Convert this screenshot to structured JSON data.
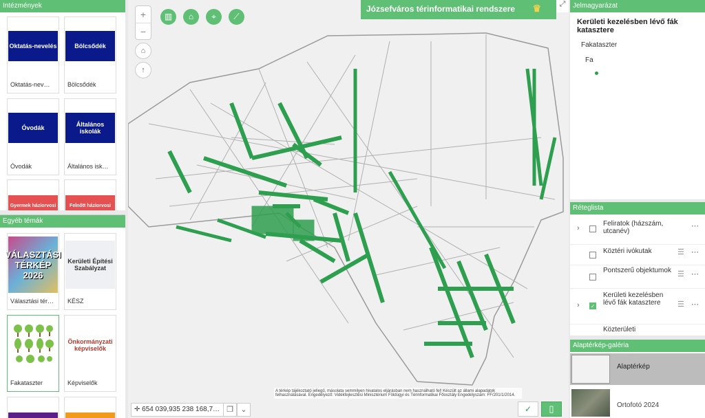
{
  "left_top": {
    "header": "Intézmények",
    "cards": [
      {
        "thumb_text": "Oktatás-nevelés",
        "caption": "Oktatás-nev…",
        "color": "#0a1a8a"
      },
      {
        "thumb_text": "Bölcsődék",
        "caption": "Bölcsődék",
        "color": "#0a1a8a"
      },
      {
        "thumb_text": "Óvodák",
        "caption": "Óvodák",
        "color": "#0a1a8a"
      },
      {
        "thumb_text": "Általános iskolák",
        "caption": "Általános isk…",
        "color": "#0a1a8a"
      },
      {
        "thumb_text": "Gyermek háziorvosi",
        "caption": "",
        "color": "#e55050"
      },
      {
        "thumb_text": "Felnőtt háziorvosi",
        "caption": "",
        "color": "#e55050"
      }
    ]
  },
  "left_bottom": {
    "header": "Egyéb témák",
    "cards": [
      {
        "thumb_text": "VÁLASZTÁSI TÉRKÉP 2026",
        "caption": "Választási tér…"
      },
      {
        "thumb_text": "Kerületi Építési Szabályzat",
        "caption": "KÉSZ"
      },
      {
        "thumb_text": "",
        "caption": "Fakataszter"
      },
      {
        "thumb_text": "Önkormányzati képviselők",
        "caption": "Képviselők"
      }
    ]
  },
  "map": {
    "title": "Józsefváros térinformatikai rendszere",
    "coordinates": "654 039,935 238 168,7…",
    "disclaimer": "A térkép tájékoztató jellegű, másolata semmilyen hivatalos eljárásban nem használható fel! Készült az állami alapadatok felhasználásával. Engedélyező: Vidékfejlesztési Minisztérium Földügyi és Térinformatikai Főosztály Engedélyszám: FF/201/1/2014.",
    "zoom_in": "+",
    "zoom_out": "−",
    "accent": "#5fbf74",
    "tree_color": "#2e9e4f"
  },
  "legend": {
    "header": "Jelmagyarázat",
    "layer_title": "Kerületi kezelésben lévő fák katasztere",
    "sub_title": "Fakataszter",
    "item_label": "Fa"
  },
  "layerlist": {
    "header": "Réteglista",
    "items": [
      {
        "label": "Feliratok (házszám, utcanév)",
        "checked": false
      },
      {
        "label": "Köztéri ivókutak",
        "checked": false
      },
      {
        "label": "Pontszerű objektumok",
        "checked": false
      },
      {
        "label": "Kerületi kezelésben lévő fák katasztere",
        "checked": true
      },
      {
        "label": "Közterületi",
        "checked": false
      }
    ]
  },
  "basemap": {
    "header": "Alaptérkép-galéria",
    "items": [
      {
        "label": "Alaptérkép"
      },
      {
        "label": "Ortofotó 2024"
      }
    ]
  }
}
